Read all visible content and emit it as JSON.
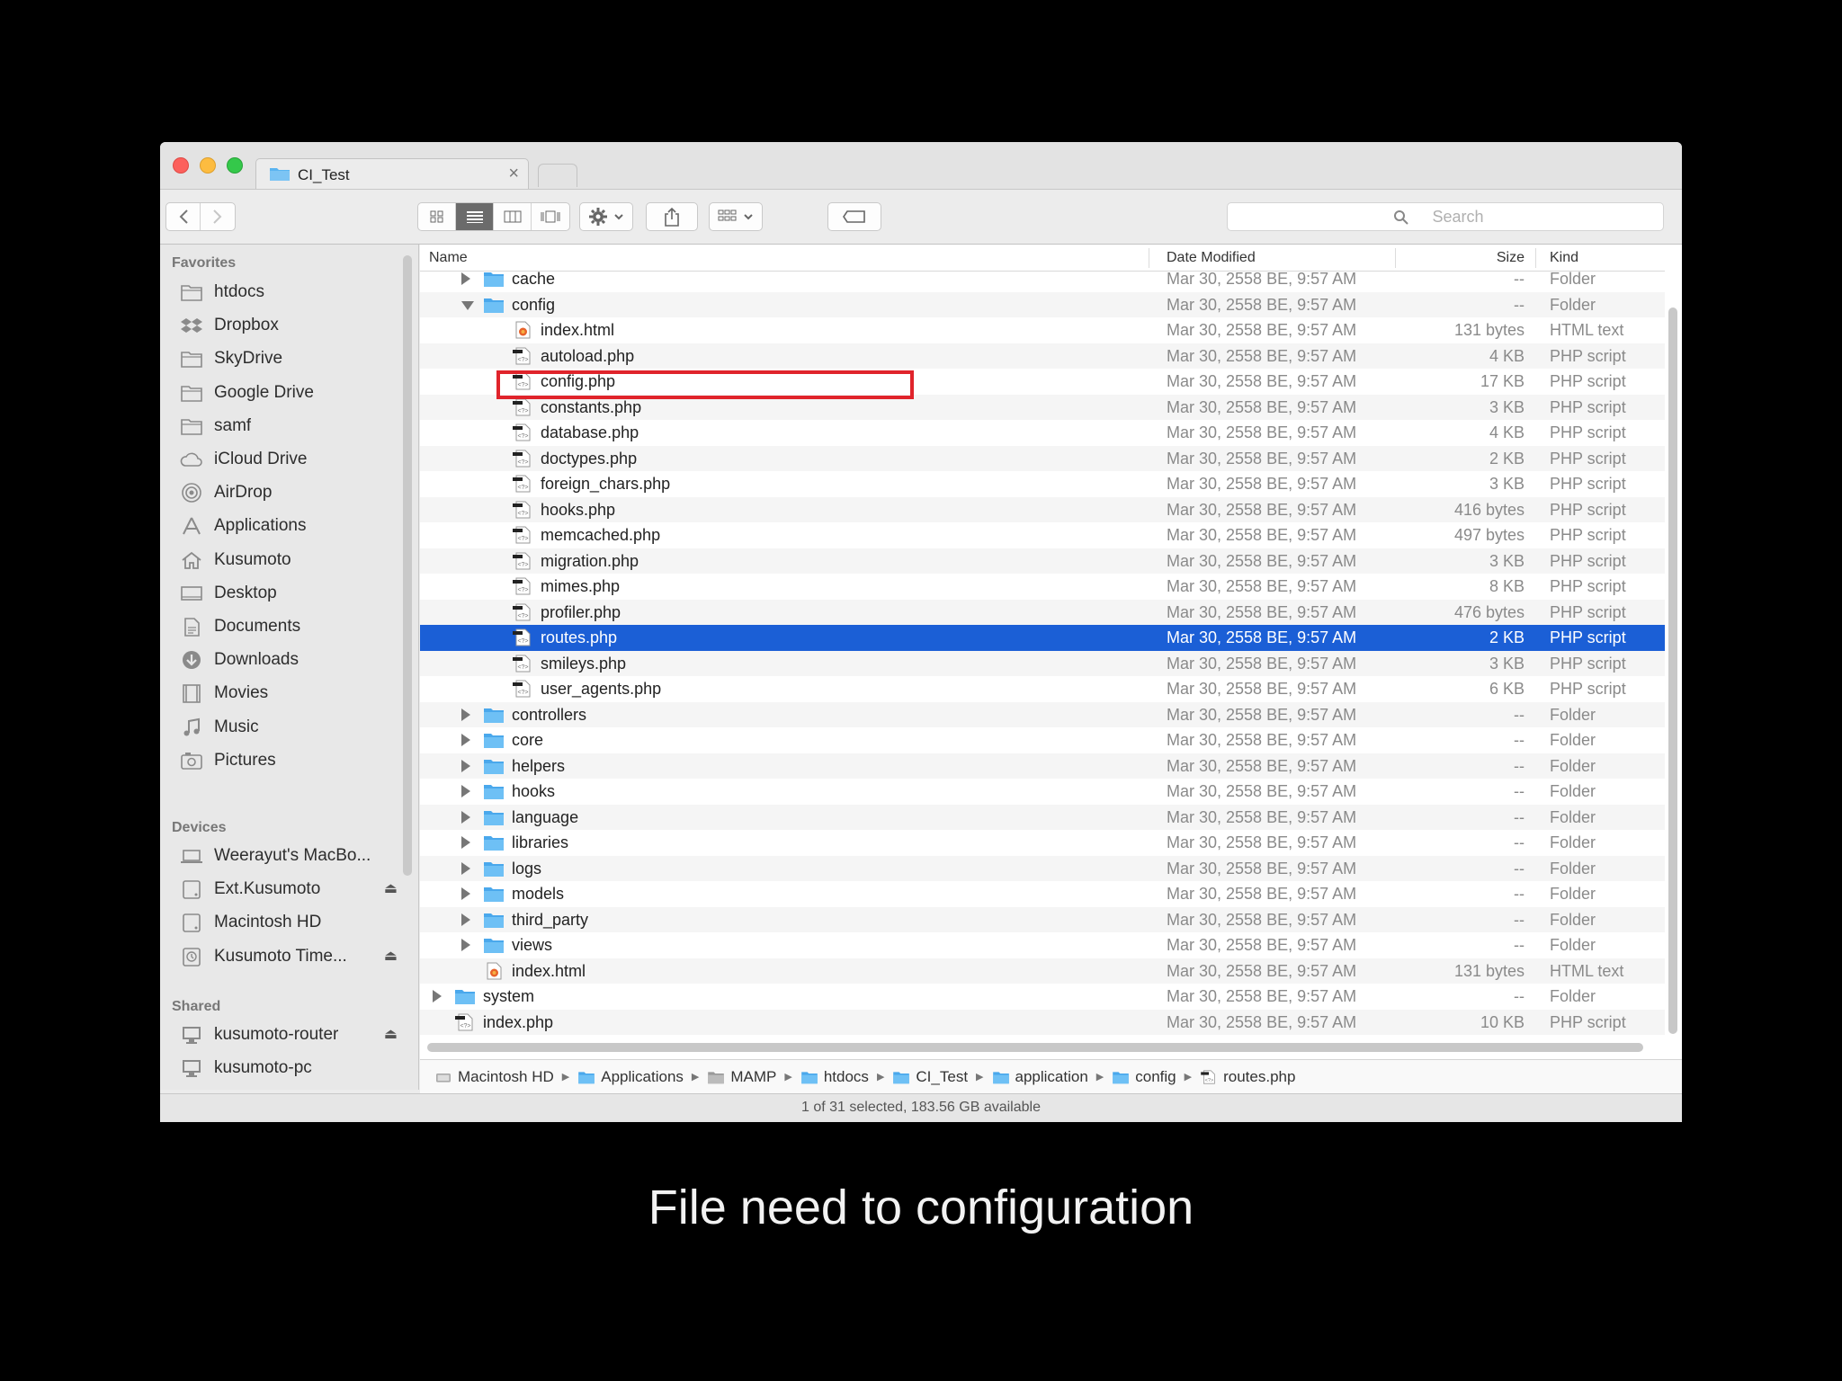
{
  "window": {
    "tab_title": "CI_Test",
    "tab_close": "×",
    "search_placeholder": "Search"
  },
  "sidebar": {
    "favorites_header": "Favorites",
    "favorites": [
      {
        "label": "htdocs",
        "icon": "folder-icon"
      },
      {
        "label": "Dropbox",
        "icon": "dropbox-icon"
      },
      {
        "label": "SkyDrive",
        "icon": "folder-icon"
      },
      {
        "label": "Google Drive",
        "icon": "folder-icon"
      },
      {
        "label": "samf",
        "icon": "folder-icon"
      },
      {
        "label": "iCloud Drive",
        "icon": "cloud-icon"
      },
      {
        "label": "AirDrop",
        "icon": "airdrop-icon"
      },
      {
        "label": "Applications",
        "icon": "applications-icon"
      },
      {
        "label": "Kusumoto",
        "icon": "home-icon"
      },
      {
        "label": "Desktop",
        "icon": "desktop-icon"
      },
      {
        "label": "Documents",
        "icon": "documents-icon"
      },
      {
        "label": "Downloads",
        "icon": "downloads-icon"
      },
      {
        "label": "Movies",
        "icon": "movies-icon"
      },
      {
        "label": "Music",
        "icon": "music-icon"
      },
      {
        "label": "Pictures",
        "icon": "pictures-icon"
      }
    ],
    "devices_header": "Devices",
    "devices": [
      {
        "label": "Weerayut's MacBo...",
        "icon": "laptop-icon",
        "eject": false
      },
      {
        "label": "Ext.Kusumoto",
        "icon": "disk-icon",
        "eject": true
      },
      {
        "label": "Macintosh HD",
        "icon": "disk-icon",
        "eject": false
      },
      {
        "label": "Kusumoto Time...",
        "icon": "timemachine-icon",
        "eject": true
      }
    ],
    "shared_header": "Shared",
    "shared": [
      {
        "label": "kusumoto-router",
        "icon": "monitor-icon",
        "eject": true
      },
      {
        "label": "kusumoto-pc",
        "icon": "monitor-icon",
        "eject": false
      }
    ],
    "eject_glyph": "⏏"
  },
  "columns": {
    "name": "Name",
    "date": "Date Modified",
    "size": "Size",
    "kind": "Kind"
  },
  "rows": [
    {
      "name": "cache",
      "type": "folder",
      "level": 1,
      "expand": "closed",
      "date": "Mar 30, 2558 BE, 9:57 AM",
      "size": "--",
      "kind": "Folder"
    },
    {
      "name": "config",
      "type": "folder",
      "level": 1,
      "expand": "open",
      "date": "Mar 30, 2558 BE, 9:57 AM",
      "size": "--",
      "kind": "Folder"
    },
    {
      "name": "index.html",
      "type": "html",
      "level": 2,
      "expand": "none",
      "date": "Mar 30, 2558 BE, 9:57 AM",
      "size": "131 bytes",
      "kind": "HTML text"
    },
    {
      "name": "autoload.php",
      "type": "php",
      "level": 2,
      "expand": "none",
      "date": "Mar 30, 2558 BE, 9:57 AM",
      "size": "4 KB",
      "kind": "PHP script"
    },
    {
      "name": "config.php",
      "type": "php",
      "level": 2,
      "expand": "none",
      "date": "Mar 30, 2558 BE, 9:57 AM",
      "size": "17 KB",
      "kind": "PHP script"
    },
    {
      "name": "constants.php",
      "type": "php",
      "level": 2,
      "expand": "none",
      "date": "Mar 30, 2558 BE, 9:57 AM",
      "size": "3 KB",
      "kind": "PHP script"
    },
    {
      "name": "database.php",
      "type": "php",
      "level": 2,
      "expand": "none",
      "date": "Mar 30, 2558 BE, 9:57 AM",
      "size": "4 KB",
      "kind": "PHP script"
    },
    {
      "name": "doctypes.php",
      "type": "php",
      "level": 2,
      "expand": "none",
      "date": "Mar 30, 2558 BE, 9:57 AM",
      "size": "2 KB",
      "kind": "PHP script"
    },
    {
      "name": "foreign_chars.php",
      "type": "php",
      "level": 2,
      "expand": "none",
      "date": "Mar 30, 2558 BE, 9:57 AM",
      "size": "3 KB",
      "kind": "PHP script"
    },
    {
      "name": "hooks.php",
      "type": "php",
      "level": 2,
      "expand": "none",
      "date": "Mar 30, 2558 BE, 9:57 AM",
      "size": "416 bytes",
      "kind": "PHP script"
    },
    {
      "name": "memcached.php",
      "type": "php",
      "level": 2,
      "expand": "none",
      "date": "Mar 30, 2558 BE, 9:57 AM",
      "size": "497 bytes",
      "kind": "PHP script"
    },
    {
      "name": "migration.php",
      "type": "php",
      "level": 2,
      "expand": "none",
      "date": "Mar 30, 2558 BE, 9:57 AM",
      "size": "3 KB",
      "kind": "PHP script"
    },
    {
      "name": "mimes.php",
      "type": "php",
      "level": 2,
      "expand": "none",
      "date": "Mar 30, 2558 BE, 9:57 AM",
      "size": "8 KB",
      "kind": "PHP script"
    },
    {
      "name": "profiler.php",
      "type": "php",
      "level": 2,
      "expand": "none",
      "date": "Mar 30, 2558 BE, 9:57 AM",
      "size": "476 bytes",
      "kind": "PHP script"
    },
    {
      "name": "routes.php",
      "type": "php",
      "level": 2,
      "expand": "none",
      "date": "Mar 30, 2558 BE, 9:57 AM",
      "size": "2 KB",
      "kind": "PHP script",
      "selected": true
    },
    {
      "name": "smileys.php",
      "type": "php",
      "level": 2,
      "expand": "none",
      "date": "Mar 30, 2558 BE, 9:57 AM",
      "size": "3 KB",
      "kind": "PHP script"
    },
    {
      "name": "user_agents.php",
      "type": "php",
      "level": 2,
      "expand": "none",
      "date": "Mar 30, 2558 BE, 9:57 AM",
      "size": "6 KB",
      "kind": "PHP script"
    },
    {
      "name": "controllers",
      "type": "folder",
      "level": 1,
      "expand": "closed",
      "date": "Mar 30, 2558 BE, 9:57 AM",
      "size": "--",
      "kind": "Folder"
    },
    {
      "name": "core",
      "type": "folder",
      "level": 1,
      "expand": "closed",
      "date": "Mar 30, 2558 BE, 9:57 AM",
      "size": "--",
      "kind": "Folder"
    },
    {
      "name": "helpers",
      "type": "folder",
      "level": 1,
      "expand": "closed",
      "date": "Mar 30, 2558 BE, 9:57 AM",
      "size": "--",
      "kind": "Folder"
    },
    {
      "name": "hooks",
      "type": "folder",
      "level": 1,
      "expand": "closed",
      "date": "Mar 30, 2558 BE, 9:57 AM",
      "size": "--",
      "kind": "Folder"
    },
    {
      "name": "language",
      "type": "folder",
      "level": 1,
      "expand": "closed",
      "date": "Mar 30, 2558 BE, 9:57 AM",
      "size": "--",
      "kind": "Folder"
    },
    {
      "name": "libraries",
      "type": "folder",
      "level": 1,
      "expand": "closed",
      "date": "Mar 30, 2558 BE, 9:57 AM",
      "size": "--",
      "kind": "Folder"
    },
    {
      "name": "logs",
      "type": "folder",
      "level": 1,
      "expand": "closed",
      "date": "Mar 30, 2558 BE, 9:57 AM",
      "size": "--",
      "kind": "Folder"
    },
    {
      "name": "models",
      "type": "folder",
      "level": 1,
      "expand": "closed",
      "date": "Mar 30, 2558 BE, 9:57 AM",
      "size": "--",
      "kind": "Folder"
    },
    {
      "name": "third_party",
      "type": "folder",
      "level": 1,
      "expand": "closed",
      "date": "Mar 30, 2558 BE, 9:57 AM",
      "size": "--",
      "kind": "Folder"
    },
    {
      "name": "views",
      "type": "folder",
      "level": 1,
      "expand": "closed",
      "date": "Mar 30, 2558 BE, 9:57 AM",
      "size": "--",
      "kind": "Folder"
    },
    {
      "name": "index.html",
      "type": "html",
      "level": 1,
      "expand": "none",
      "date": "Mar 30, 2558 BE, 9:57 AM",
      "size": "131 bytes",
      "kind": "HTML text"
    },
    {
      "name": "system",
      "type": "folder",
      "level": 0,
      "expand": "closed",
      "date": "Mar 30, 2558 BE, 9:57 AM",
      "size": "--",
      "kind": "Folder"
    },
    {
      "name": "index.php",
      "type": "php",
      "level": 0,
      "expand": "none",
      "date": "Mar 30, 2558 BE, 9:57 AM",
      "size": "10 KB",
      "kind": "PHP script"
    }
  ],
  "pathbar": [
    {
      "label": "Macintosh HD",
      "icon": "disk-icon"
    },
    {
      "label": "Applications",
      "icon": "applications-folder-icon"
    },
    {
      "label": "MAMP",
      "icon": "folder-icon"
    },
    {
      "label": "htdocs",
      "icon": "folder-icon"
    },
    {
      "label": "CI_Test",
      "icon": "folder-icon"
    },
    {
      "label": "application",
      "icon": "folder-icon"
    },
    {
      "label": "config",
      "icon": "folder-icon"
    },
    {
      "label": "routes.php",
      "icon": "php-file-icon"
    }
  ],
  "pathbar_separator": "▶",
  "status": "1 of 31 selected, 183.56 GB available",
  "caption": "File need to configuration",
  "colors": {
    "selection": "#1b5fd6",
    "folder_blue": "#5ab4f0",
    "highlight_red": "#e0242b"
  }
}
